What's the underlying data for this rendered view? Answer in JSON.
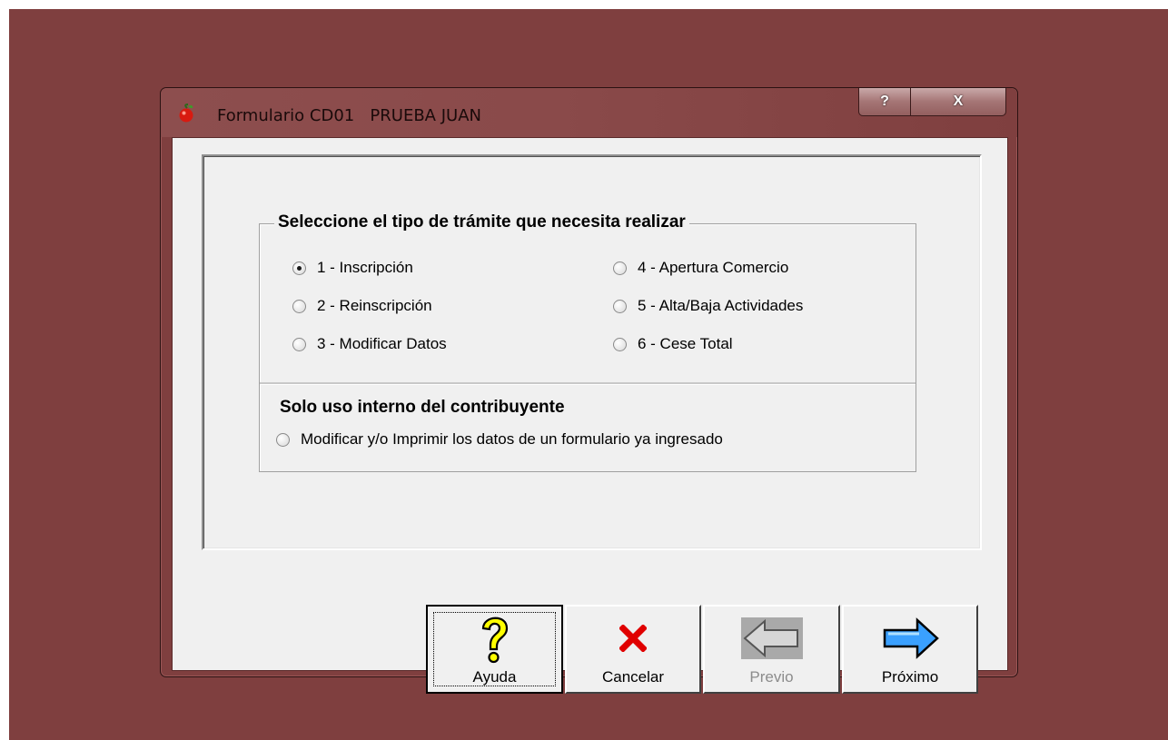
{
  "window": {
    "title": "Formulario CD01   PRUEBA JUAN",
    "help_button": "?",
    "close_button": "X",
    "app_icon": "apple-icon"
  },
  "group": {
    "title": "Seleccione el tipo de trámite que necesita realizar",
    "options": [
      {
        "label": "1 - Inscripción",
        "checked": true
      },
      {
        "label": "2 - Reinscripción",
        "checked": false
      },
      {
        "label": "3 - Modificar Datos",
        "checked": false
      },
      {
        "label": "4 - Apertura Comercio",
        "checked": false
      },
      {
        "label": "5 - Alta/Baja Actividades",
        "checked": false
      },
      {
        "label": "6 - Cese Total",
        "checked": false
      }
    ],
    "internal_title": "Solo uso interno del contribuyente",
    "internal_option": {
      "label": "Modificar y/o Imprimir los datos de un formulario ya ingresado",
      "checked": false
    }
  },
  "buttons": {
    "ayuda": {
      "label": "Ayuda",
      "icon": "question-mark-icon"
    },
    "cancelar": {
      "label": "Cancelar",
      "icon": "red-x-icon"
    },
    "previo": {
      "label": "Previo",
      "icon": "left-arrow-icon",
      "enabled": false
    },
    "proximo": {
      "label": "Próximo",
      "icon": "right-arrow-icon"
    }
  },
  "colors": {
    "desktop": "#7f3f3f",
    "dialog_bg": "#f0f0f0",
    "next_arrow": "#3aa0ff",
    "cancel_x": "#e00000",
    "help_icon": "#ffff00"
  }
}
